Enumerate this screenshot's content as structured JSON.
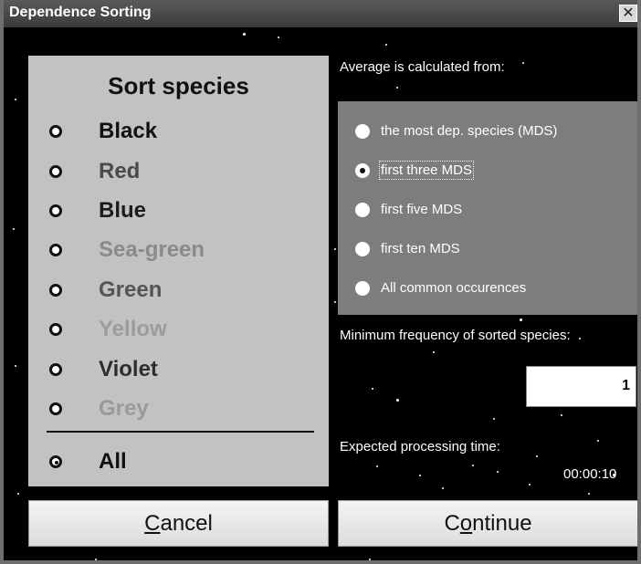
{
  "window": {
    "title": "Dependence Sorting",
    "close_glyph": "✕"
  },
  "sort_panel": {
    "heading": "Sort species",
    "items": [
      {
        "label": "Black",
        "color": "#111111",
        "checked": false
      },
      {
        "label": "Red",
        "color": "#4a4a4a",
        "checked": false
      },
      {
        "label": "Blue",
        "color": "#1c1c1c",
        "checked": false
      },
      {
        "label": "Sea-green",
        "color": "#8a8a8a",
        "checked": false
      },
      {
        "label": "Green",
        "color": "#555555",
        "checked": false
      },
      {
        "label": "Yellow",
        "color": "#9c9c9c",
        "checked": false
      },
      {
        "label": "Violet",
        "color": "#2e2e2e",
        "checked": false
      },
      {
        "label": "Grey",
        "color": "#9a9a9a",
        "checked": false
      }
    ],
    "all": {
      "label": "All",
      "color": "#111111",
      "checked": true
    }
  },
  "average": {
    "label": "Average is calculated from:",
    "options": [
      {
        "label": "the most dep. species (MDS)",
        "checked": false,
        "focused": false
      },
      {
        "label": "first three MDS",
        "checked": true,
        "focused": true
      },
      {
        "label": "first five MDS",
        "checked": false,
        "focused": false
      },
      {
        "label": "first ten MDS",
        "checked": false,
        "focused": false
      },
      {
        "label": "All common occurences",
        "checked": false,
        "focused": false
      }
    ]
  },
  "min_frequency": {
    "label": "Minimum frequency of sorted species:",
    "value": "1"
  },
  "expected_time": {
    "label": "Expected processing time:",
    "value": "00:00:10"
  },
  "buttons": {
    "cancel": {
      "pre": "",
      "accel": "C",
      "post": "ancel"
    },
    "continue": {
      "pre": "C",
      "accel": "o",
      "post": "ntinue"
    }
  }
}
